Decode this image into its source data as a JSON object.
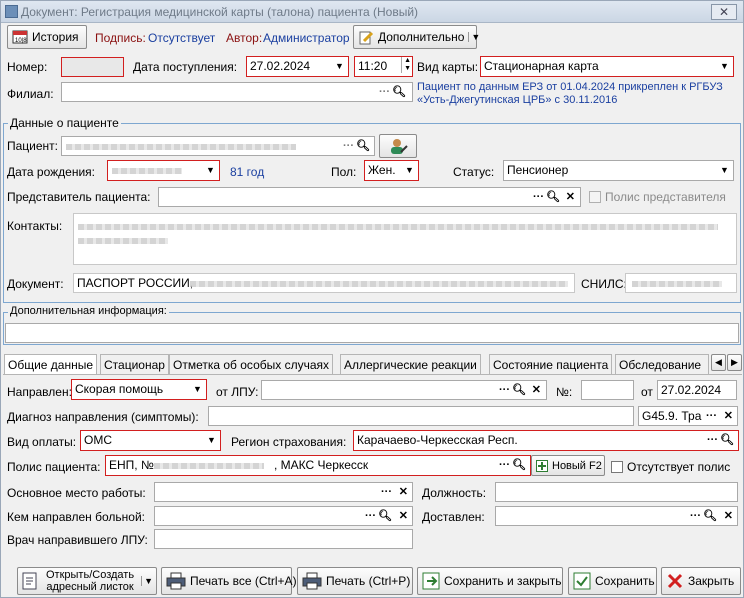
{
  "window": {
    "title": "Документ: Регистрация медицинской карты (талона) пациента (Новый)",
    "close": "✕"
  },
  "toolbar": {
    "history": "История",
    "signature_label": "Подпись:",
    "signature_value": "Отсутствует",
    "author_label": "Автор:",
    "author_value": "Администратор",
    "extra": "Дополнительно"
  },
  "header": {
    "number_label": "Номер:",
    "date_label": "Дата поступления:",
    "date": "27.02.2024",
    "time": "11:20",
    "card_type_label": "Вид карты:",
    "card_type": "Стационарная карта",
    "branch_label": "Филиал:",
    "erz_note": "Пациент по данным ЕРЗ от 01.04.2024 прикреплен к РГБУЗ «Усть-Джегутинская ЦРБ» с 30.11.2016"
  },
  "patient": {
    "group": "Данные о пациенте",
    "patient_label": "Пациент:",
    "dob_label": "Дата рождения:",
    "age": "81 год",
    "sex_label": "Пол:",
    "sex": "Жен.",
    "status_label": "Статус:",
    "status": "Пенсионер",
    "rep_label": "Представитель пациента:",
    "rep_policy": "Полис представителя",
    "contacts_label": "Контакты:",
    "doc_label": "Документ:",
    "doc": "ПАСПОРТ РОССИИ,",
    "snils_label": "СНИЛС:"
  },
  "extra_info": {
    "label": "Дополнительная информация:"
  },
  "tabs": [
    "Общие данные",
    "Стационар",
    "Отметка об особых случаях",
    "Аллергические реакции",
    "Состояние пациента",
    "Обследование"
  ],
  "general": {
    "directed_label": "Направлен:",
    "directed": "Скорая помощь",
    "from_lpu_label": "от ЛПУ:",
    "num_label": "№:",
    "from_label": "от",
    "from_date": "27.02.2024",
    "diag_label": "Диагноз направления (симптомы):",
    "diag_code": "G45.9. Тра",
    "payment_label": "Вид оплаты:",
    "payment": "ОМС",
    "region_label": "Регион страхования:",
    "region": "Карачаево-Черкесская Респ.",
    "policy_label": "Полис пациента:",
    "policy": "ЕНП, №",
    "policy_tail": ", МАКС Черкесск",
    "new_policy": "Новый F2",
    "no_policy": "Отсутствует полис",
    "work_label": "Основное место работы:",
    "position_label": "Должность:",
    "sent_by_label": "Кем направлен больной:",
    "delivered_label": "Доставлен:",
    "doctor_label": "Врач направившего ЛПУ:"
  },
  "footer": {
    "open_address": "Открыть/Создать адресный листок",
    "print_all": "Печать все (Ctrl+A)",
    "print": "Печать (Ctrl+P)",
    "save_close": "Сохранить и закрыть",
    "save": "Сохранить",
    "close": "Закрыть"
  },
  "colors": {
    "required_border": "#d21f1f",
    "link_blue": "#1a3fa0",
    "group_border": "#7ea7d0"
  }
}
